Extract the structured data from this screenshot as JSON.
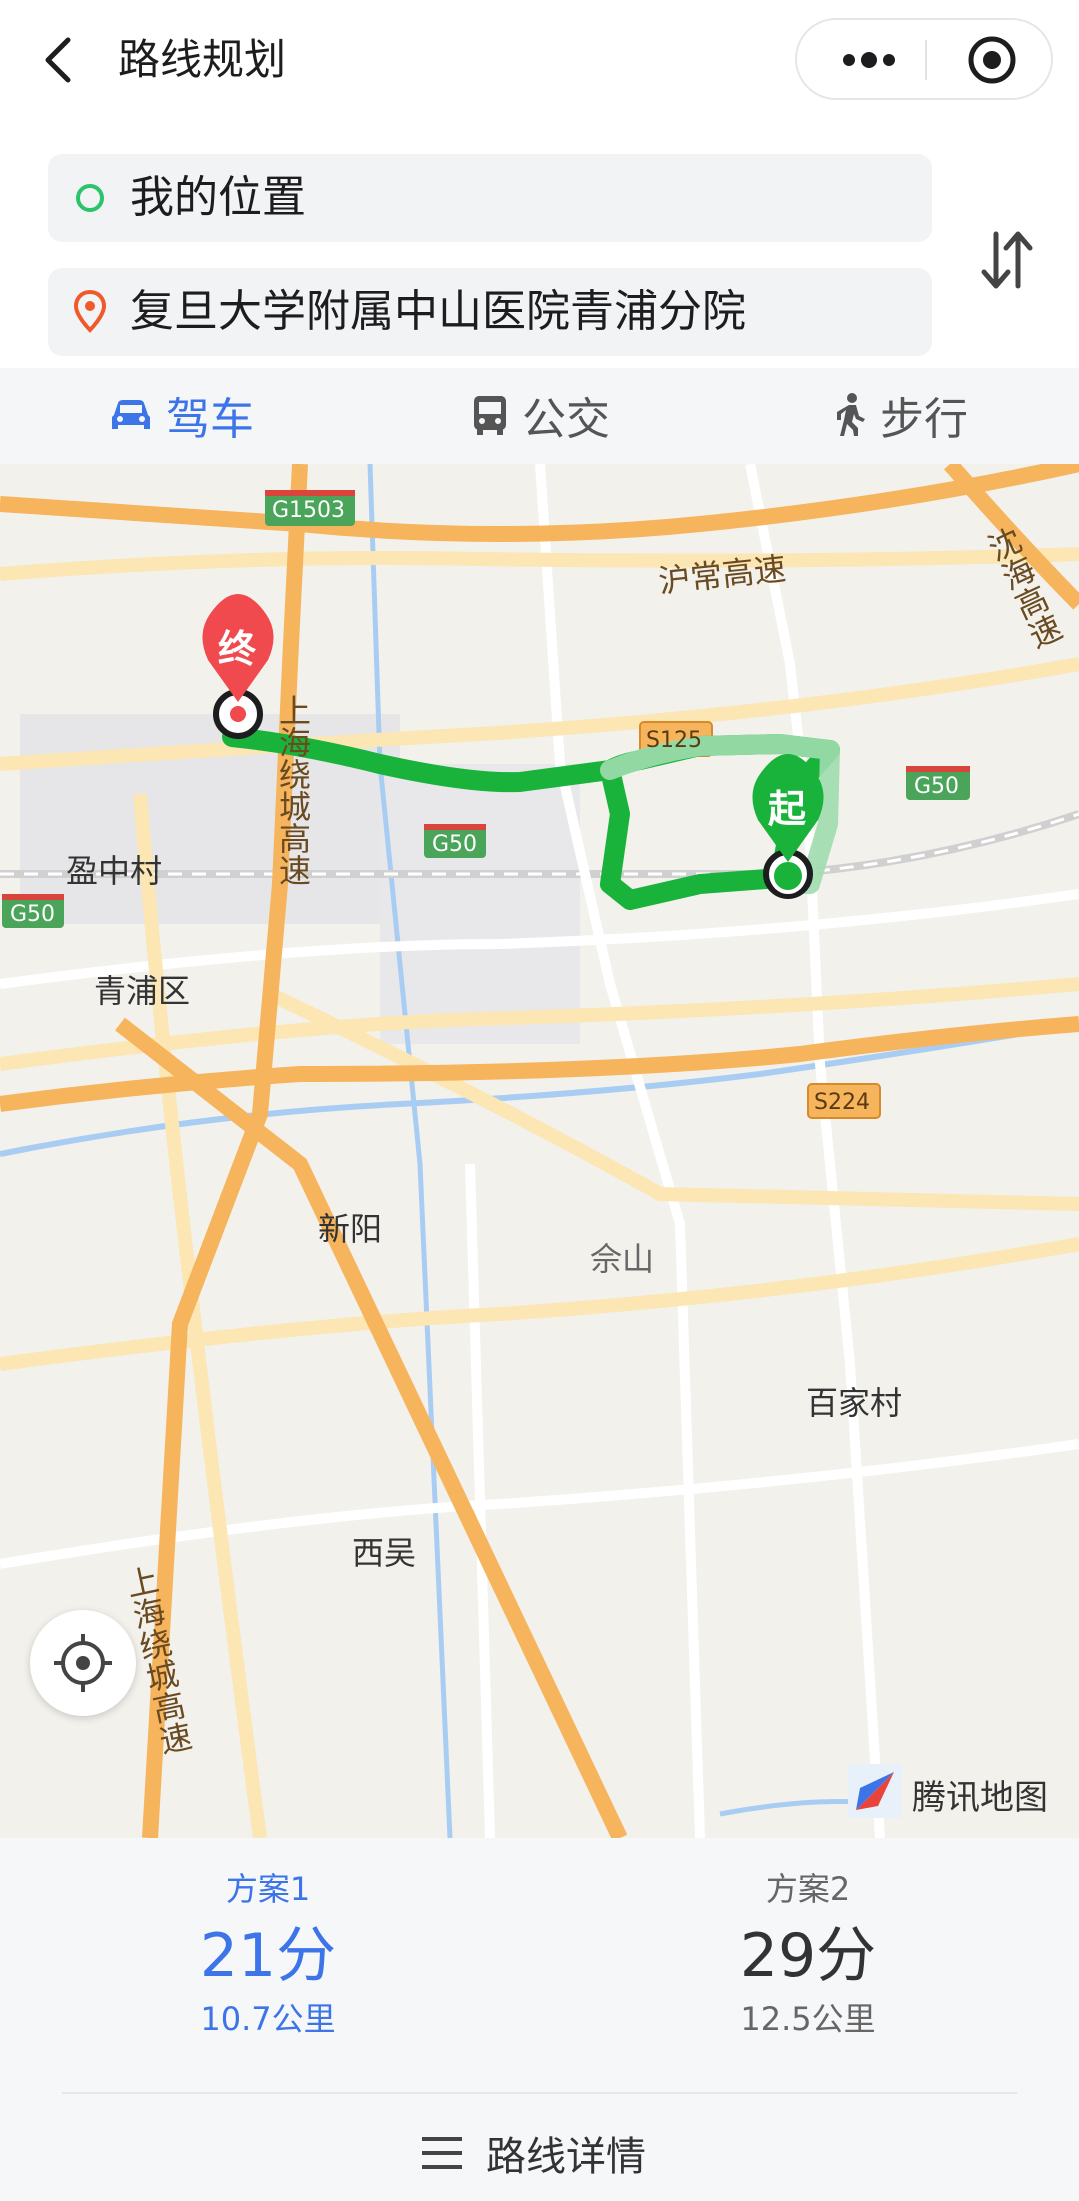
{
  "header": {
    "title": "路线规划",
    "icons": {
      "back": "chevron-left-icon",
      "more": "more-dots-icon",
      "target": "target-icon"
    }
  },
  "route_inputs": {
    "start": {
      "text": "我的位置",
      "icon": "start-circle-icon",
      "color": "#2cc36b"
    },
    "end": {
      "text": "复旦大学附属中山医院青浦分院",
      "icon": "location-pin-icon",
      "color": "#f05a2b"
    },
    "swap_icon": "swap-arrows-icon"
  },
  "modes": [
    {
      "label": "驾车",
      "icon": "car-icon",
      "selected": true
    },
    {
      "label": "公交",
      "icon": "bus-icon",
      "selected": false
    },
    {
      "label": "步行",
      "icon": "walk-icon",
      "selected": false
    }
  ],
  "map": {
    "labels": {
      "place1": "盈中村",
      "place2": "青浦区",
      "place3": "新阳",
      "place4": "佘山",
      "place5": "百家村",
      "place6": "西吴",
      "road1": "沪常高速",
      "road2": "沈海高速",
      "road3": "上海绕城高速",
      "road4": "上海绕城高速"
    },
    "shields": [
      "G1503",
      "S125",
      "G50",
      "G50",
      "G50",
      "S224"
    ],
    "markers": {
      "start": "起",
      "end": "终"
    },
    "route_color": "#19b33c",
    "logo_text": "腾讯地图",
    "locate_icon": "locate-crosshair-icon"
  },
  "plans": [
    {
      "name": "方案1",
      "time": "21分",
      "distance": "10.7公里",
      "selected": true
    },
    {
      "name": "方案2",
      "time": "29分",
      "distance": "12.5公里",
      "selected": false
    }
  ],
  "details": {
    "label": "路线详情",
    "icon": "list-icon"
  },
  "colors": {
    "accent": "#3d74e8",
    "route": "#19b33c",
    "end_marker": "#f04a4f"
  }
}
